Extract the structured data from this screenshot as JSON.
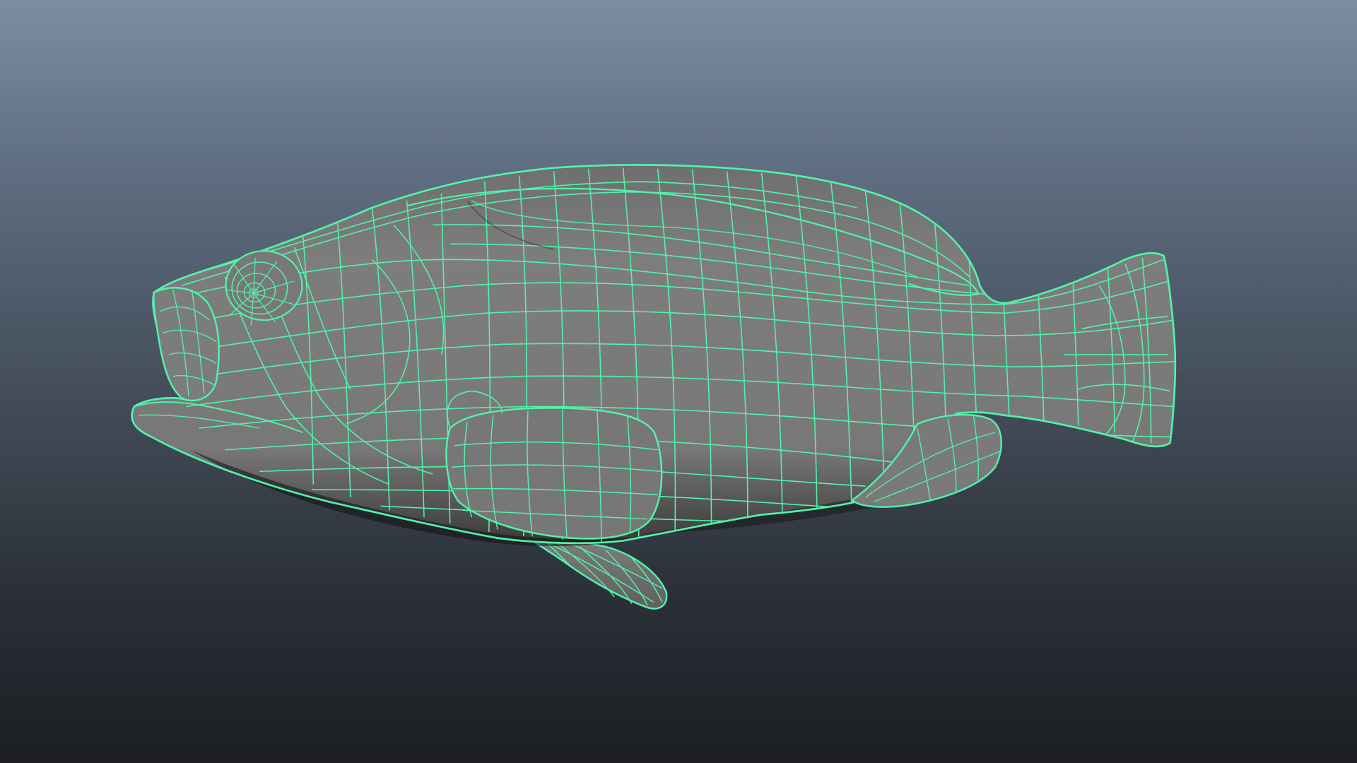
{
  "viewport": {
    "label": "",
    "background_top": "#7c8da3",
    "background_bottom": "#1c1e22"
  },
  "model": {
    "subject": "fish",
    "display_mode": "wireframe-on-shaded",
    "shaded_color": "#7a7a7a",
    "wire_color": "#52f2ab"
  }
}
